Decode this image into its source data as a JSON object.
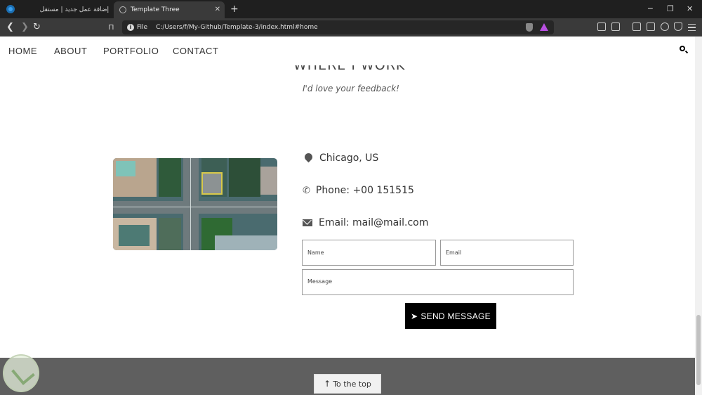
{
  "browser": {
    "tabs": [
      {
        "label": "إضافة عمل جديد | مستقل",
        "active": false
      },
      {
        "label": "Template Three",
        "active": true
      }
    ],
    "file_label": "File",
    "url": "C:/Users/f/My-Github/Template-3/index.html#home"
  },
  "nav": {
    "items": [
      "HOME",
      "ABOUT",
      "PORTFOLIO",
      "CONTACT"
    ]
  },
  "contact": {
    "title": "WHERE I WORK",
    "subtitle": "I'd love your feedback!",
    "location": "Chicago, US",
    "phone": "Phone: +00 151515",
    "email": "Email: mail@mail.com",
    "name_placeholder": "Name",
    "email_placeholder": "Email",
    "message_placeholder": "Message",
    "send_label": "SEND MESSAGE"
  },
  "footer": {
    "to_top_label": "To the top"
  },
  "colors": {
    "nav_text": "#333333",
    "button_bg": "#000000",
    "footer_bg": "#5f5f5f"
  }
}
